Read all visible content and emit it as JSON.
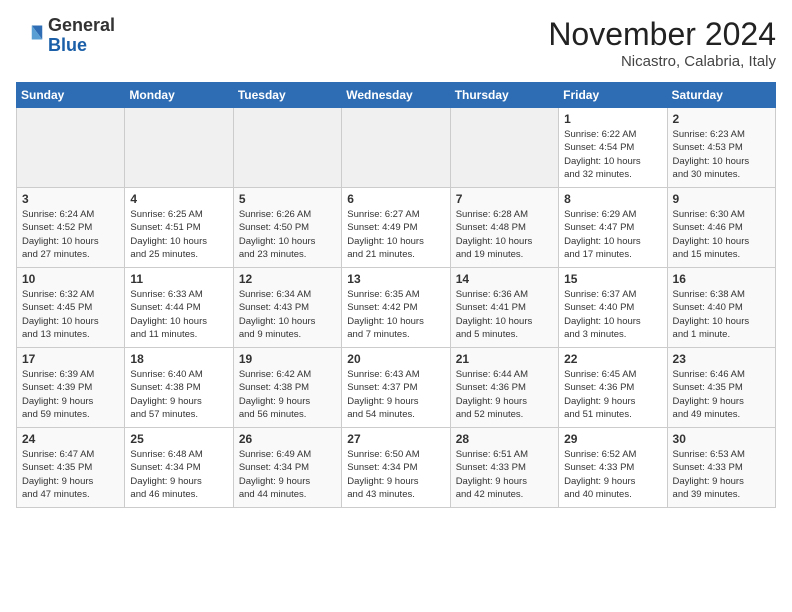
{
  "header": {
    "logo_general": "General",
    "logo_blue": "Blue",
    "month_title": "November 2024",
    "location": "Nicastro, Calabria, Italy"
  },
  "days_of_week": [
    "Sunday",
    "Monday",
    "Tuesday",
    "Wednesday",
    "Thursday",
    "Friday",
    "Saturday"
  ],
  "weeks": [
    [
      {
        "num": "",
        "info": "",
        "empty": true
      },
      {
        "num": "",
        "info": "",
        "empty": true
      },
      {
        "num": "",
        "info": "",
        "empty": true
      },
      {
        "num": "",
        "info": "",
        "empty": true
      },
      {
        "num": "",
        "info": "",
        "empty": true
      },
      {
        "num": "1",
        "info": "Sunrise: 6:22 AM\nSunset: 4:54 PM\nDaylight: 10 hours\nand 32 minutes."
      },
      {
        "num": "2",
        "info": "Sunrise: 6:23 AM\nSunset: 4:53 PM\nDaylight: 10 hours\nand 30 minutes."
      }
    ],
    [
      {
        "num": "3",
        "info": "Sunrise: 6:24 AM\nSunset: 4:52 PM\nDaylight: 10 hours\nand 27 minutes."
      },
      {
        "num": "4",
        "info": "Sunrise: 6:25 AM\nSunset: 4:51 PM\nDaylight: 10 hours\nand 25 minutes."
      },
      {
        "num": "5",
        "info": "Sunrise: 6:26 AM\nSunset: 4:50 PM\nDaylight: 10 hours\nand 23 minutes."
      },
      {
        "num": "6",
        "info": "Sunrise: 6:27 AM\nSunset: 4:49 PM\nDaylight: 10 hours\nand 21 minutes."
      },
      {
        "num": "7",
        "info": "Sunrise: 6:28 AM\nSunset: 4:48 PM\nDaylight: 10 hours\nand 19 minutes."
      },
      {
        "num": "8",
        "info": "Sunrise: 6:29 AM\nSunset: 4:47 PM\nDaylight: 10 hours\nand 17 minutes."
      },
      {
        "num": "9",
        "info": "Sunrise: 6:30 AM\nSunset: 4:46 PM\nDaylight: 10 hours\nand 15 minutes."
      }
    ],
    [
      {
        "num": "10",
        "info": "Sunrise: 6:32 AM\nSunset: 4:45 PM\nDaylight: 10 hours\nand 13 minutes."
      },
      {
        "num": "11",
        "info": "Sunrise: 6:33 AM\nSunset: 4:44 PM\nDaylight: 10 hours\nand 11 minutes."
      },
      {
        "num": "12",
        "info": "Sunrise: 6:34 AM\nSunset: 4:43 PM\nDaylight: 10 hours\nand 9 minutes."
      },
      {
        "num": "13",
        "info": "Sunrise: 6:35 AM\nSunset: 4:42 PM\nDaylight: 10 hours\nand 7 minutes."
      },
      {
        "num": "14",
        "info": "Sunrise: 6:36 AM\nSunset: 4:41 PM\nDaylight: 10 hours\nand 5 minutes."
      },
      {
        "num": "15",
        "info": "Sunrise: 6:37 AM\nSunset: 4:40 PM\nDaylight: 10 hours\nand 3 minutes."
      },
      {
        "num": "16",
        "info": "Sunrise: 6:38 AM\nSunset: 4:40 PM\nDaylight: 10 hours\nand 1 minute."
      }
    ],
    [
      {
        "num": "17",
        "info": "Sunrise: 6:39 AM\nSunset: 4:39 PM\nDaylight: 9 hours\nand 59 minutes."
      },
      {
        "num": "18",
        "info": "Sunrise: 6:40 AM\nSunset: 4:38 PM\nDaylight: 9 hours\nand 57 minutes."
      },
      {
        "num": "19",
        "info": "Sunrise: 6:42 AM\nSunset: 4:38 PM\nDaylight: 9 hours\nand 56 minutes."
      },
      {
        "num": "20",
        "info": "Sunrise: 6:43 AM\nSunset: 4:37 PM\nDaylight: 9 hours\nand 54 minutes."
      },
      {
        "num": "21",
        "info": "Sunrise: 6:44 AM\nSunset: 4:36 PM\nDaylight: 9 hours\nand 52 minutes."
      },
      {
        "num": "22",
        "info": "Sunrise: 6:45 AM\nSunset: 4:36 PM\nDaylight: 9 hours\nand 51 minutes."
      },
      {
        "num": "23",
        "info": "Sunrise: 6:46 AM\nSunset: 4:35 PM\nDaylight: 9 hours\nand 49 minutes."
      }
    ],
    [
      {
        "num": "24",
        "info": "Sunrise: 6:47 AM\nSunset: 4:35 PM\nDaylight: 9 hours\nand 47 minutes."
      },
      {
        "num": "25",
        "info": "Sunrise: 6:48 AM\nSunset: 4:34 PM\nDaylight: 9 hours\nand 46 minutes."
      },
      {
        "num": "26",
        "info": "Sunrise: 6:49 AM\nSunset: 4:34 PM\nDaylight: 9 hours\nand 44 minutes."
      },
      {
        "num": "27",
        "info": "Sunrise: 6:50 AM\nSunset: 4:34 PM\nDaylight: 9 hours\nand 43 minutes."
      },
      {
        "num": "28",
        "info": "Sunrise: 6:51 AM\nSunset: 4:33 PM\nDaylight: 9 hours\nand 42 minutes."
      },
      {
        "num": "29",
        "info": "Sunrise: 6:52 AM\nSunset: 4:33 PM\nDaylight: 9 hours\nand 40 minutes."
      },
      {
        "num": "30",
        "info": "Sunrise: 6:53 AM\nSunset: 4:33 PM\nDaylight: 9 hours\nand 39 minutes."
      }
    ]
  ]
}
